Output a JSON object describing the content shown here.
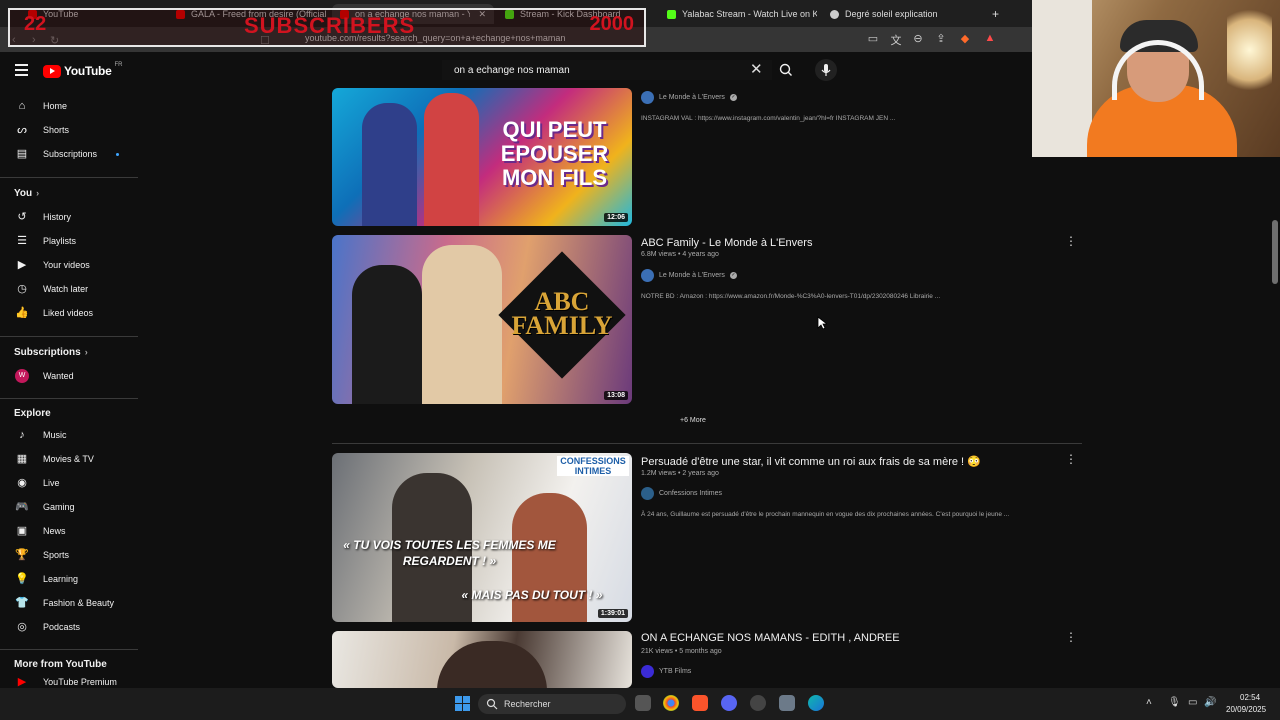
{
  "browser": {
    "tabs": [
      {
        "label": "YouTube",
        "color": "#ff0000"
      },
      {
        "label": "GALA - Freed from desire (Official V...",
        "color": "#ff0000"
      },
      {
        "label": "on a echange nos maman - YouT...",
        "color": "#ff0000",
        "active": true
      },
      {
        "label": "Stream - Kick Dashboard",
        "color": "#53fc18"
      },
      {
        "label": "Yalabac Stream - Watch Live on Kick",
        "color": "#53fc18"
      },
      {
        "label": "Degré soleil explication",
        "color": "#cccccc"
      }
    ],
    "tab_close": "✕",
    "new_tab": "+",
    "url": "youtube.com/results?search_query=on+a+echange+nos+maman"
  },
  "overlay": {
    "count": "22",
    "label": "SUBSCRIBERS",
    "goal": "2000"
  },
  "youtube": {
    "logo_text": "YouTube",
    "region": "FR",
    "search_query": "on a echange nos maman",
    "sidebar": {
      "main": [
        {
          "label": "Home",
          "icon": "home-icon"
        },
        {
          "label": "Shorts",
          "icon": "shorts-icon"
        },
        {
          "label": "Subscriptions",
          "icon": "subscriptions-icon"
        }
      ],
      "you_header": "You",
      "you": [
        {
          "label": "History",
          "icon": "history-icon"
        },
        {
          "label": "Playlists",
          "icon": "playlists-icon"
        },
        {
          "label": "Your videos",
          "icon": "your-videos-icon"
        },
        {
          "label": "Watch later",
          "icon": "watch-later-icon"
        },
        {
          "label": "Liked videos",
          "icon": "liked-videos-icon"
        }
      ],
      "subs_header": "Subscriptions",
      "subs": [
        {
          "label": "Wanted",
          "avatar": "W",
          "color": "#c2185b"
        }
      ],
      "explore_header": "Explore",
      "explore": [
        {
          "label": "Music",
          "icon": "music-icon"
        },
        {
          "label": "Movies & TV",
          "icon": "movies-icon"
        },
        {
          "label": "Live",
          "icon": "live-icon"
        },
        {
          "label": "Gaming",
          "icon": "gaming-icon"
        },
        {
          "label": "News",
          "icon": "news-icon"
        },
        {
          "label": "Sports",
          "icon": "sports-icon"
        },
        {
          "label": "Learning",
          "icon": "learning-icon"
        },
        {
          "label": "Fashion & Beauty",
          "icon": "fashion-icon"
        },
        {
          "label": "Podcasts",
          "icon": "podcasts-icon"
        }
      ],
      "more_header": "More from YouTube",
      "more": [
        {
          "label": "YouTube Premium",
          "icon": "youtube-premium-icon"
        }
      ]
    },
    "results": [
      {
        "duration": "12:06",
        "thumb_text": "QUI PEUT EPOUSER MON FILS",
        "channel": "Le Monde à L'Envers",
        "description": "INSTAGRAM VAL : https://www.instagram.com/valentin_jean/?hl=fr INSTAGRAM JEN ..."
      },
      {
        "title": "ABC Family - Le Monde à L'Envers",
        "meta": "6.8M views • 4 years ago",
        "duration": "13:08",
        "thumb_text": "ABC FAMILY",
        "channel": "Le Monde à L'Envers",
        "description": "NOTRE BD : Amazon : https://www.amazon.fr/Monde-%C3%A0-lenvers-T01/dp/2302080246 Librairie ..."
      },
      {
        "title": "Persuadé d'être une star, il vit comme un roi aux frais de sa mère ! 😳",
        "meta": "1.2M views • 2 years ago",
        "duration": "1:39:01",
        "thumb_badge": "CONFESSIONS INTIMES",
        "thumb_quote1": "« TU VOIS TOUTES LES FEMMES ME REGARDENT ! »",
        "thumb_quote2": "« MAIS PAS DU TOUT ! »",
        "channel": "Confessions Intimes",
        "description": "À 24 ans, Guillaume est persuadé d'être le prochain mannequin en vogue des dix prochaines années. C'est pourquoi le jeune ..."
      },
      {
        "title": "ON A ECHANGE NOS MAMANS - EDITH , ANDREE",
        "meta": "21K views • 5 months ago",
        "channel": "YTB Films"
      }
    ],
    "more_results": "+6 More",
    "overflow_glyph": "⋮",
    "verified_glyph": "✓"
  },
  "taskbar": {
    "search_label": "Rechercher",
    "time": "02:54",
    "date": "20/09/2025"
  },
  "colors": {
    "accent": "#ff0000",
    "overlay_text": "#d1131f",
    "background": "#0f0f0f"
  }
}
